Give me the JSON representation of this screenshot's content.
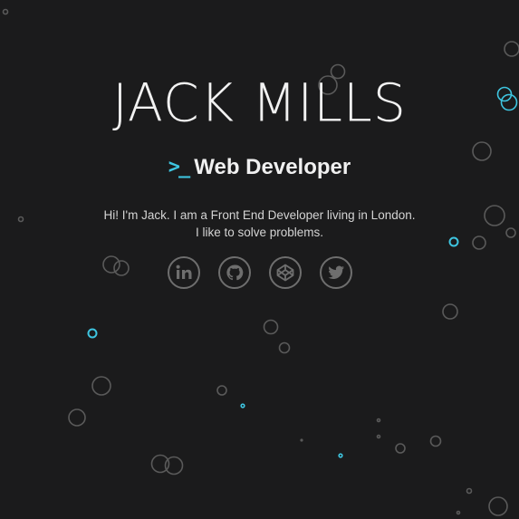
{
  "profile": {
    "name": "JACK MILLS",
    "prompt_symbol": ">_",
    "role": "Web Developer",
    "bio_line1": "Hi! I'm Jack. I am a Front End Developer living in London.",
    "bio_line2": "I like to solve problems."
  },
  "socials": [
    {
      "name": "linkedin",
      "icon": "linkedin-icon"
    },
    {
      "name": "github",
      "icon": "github-icon"
    },
    {
      "name": "codepen",
      "icon": "codepen-icon"
    },
    {
      "name": "twitter",
      "icon": "twitter-icon"
    }
  ],
  "colors": {
    "background": "#1b1b1c",
    "accent": "#3ec5e0",
    "bubble": "#5a5a5a",
    "text": "#f2f2f2"
  }
}
